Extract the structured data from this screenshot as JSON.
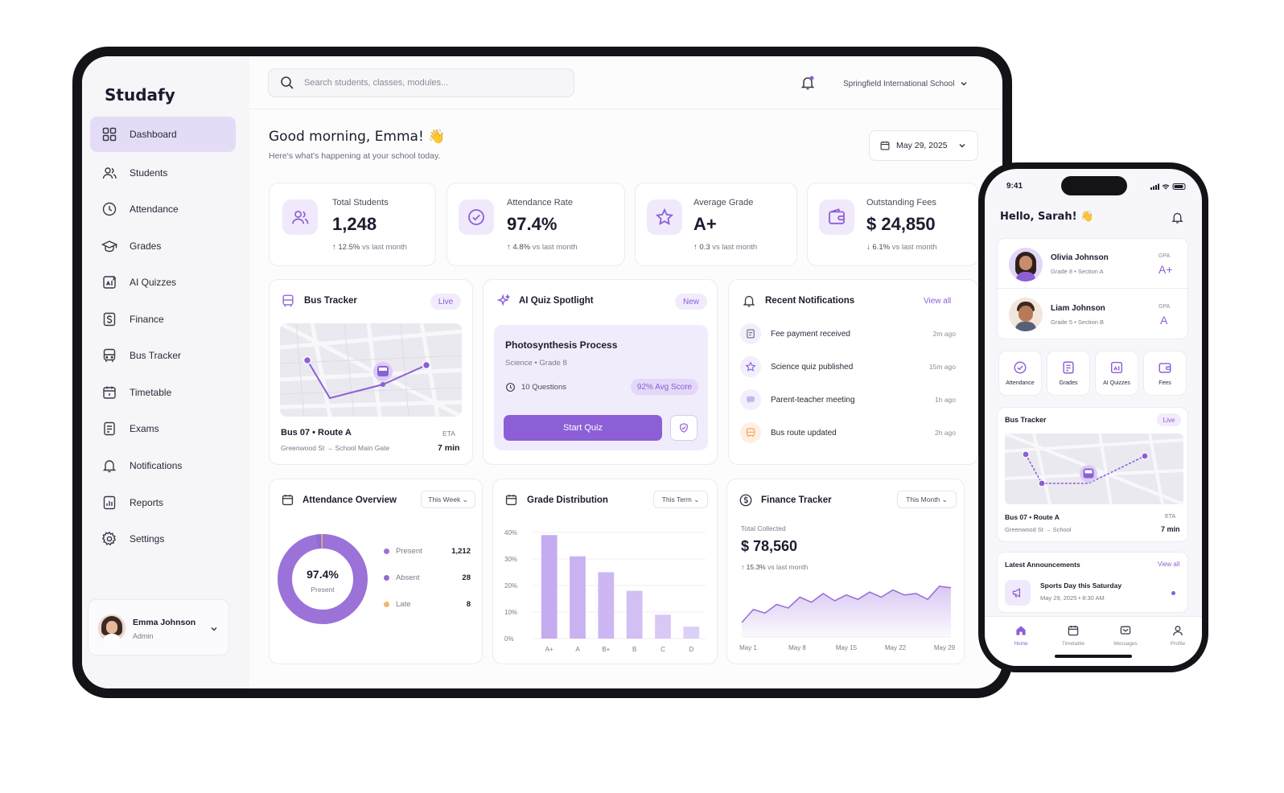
{
  "app": {
    "name": "Studafy"
  },
  "search": {
    "placeholder": "Search students, classes, modules..."
  },
  "school": "Springfield International School",
  "greeting": {
    "title": "Good morning, Emma! 👋",
    "subtitle": "Here's what's happening at your school today."
  },
  "date": "May 29, 2025",
  "nav": [
    {
      "label": "Dashboard",
      "icon": "grid-icon",
      "active": true
    },
    {
      "label": "Students",
      "icon": "users-icon"
    },
    {
      "label": "Attendance",
      "icon": "clock-icon"
    },
    {
      "label": "Grades",
      "icon": "graduation-cap-icon"
    },
    {
      "label": "AI Quizzes",
      "icon": "quiz-icon"
    },
    {
      "label": "Finance",
      "icon": "dollar-icon"
    },
    {
      "label": "Bus Tracker",
      "icon": "bus-icon"
    },
    {
      "label": "Timetable",
      "icon": "calendar-icon"
    },
    {
      "label": "Exams",
      "icon": "exam-icon"
    },
    {
      "label": "Notifications",
      "icon": "bell-icon"
    },
    {
      "label": "Reports",
      "icon": "report-icon"
    },
    {
      "label": "Settings",
      "icon": "gear-icon"
    }
  ],
  "user": {
    "name": "Emma Johnson",
    "role": "Admin"
  },
  "stats": [
    {
      "label": "Total Students",
      "value": "1,248",
      "delta": "12.5%",
      "delta_text": "vs last month",
      "direction": "up",
      "icon": "users-icon"
    },
    {
      "label": "Attendance Rate",
      "value": "97.4%",
      "delta": "4.8%",
      "delta_text": "vs last month",
      "direction": "up",
      "icon": "check-circle-icon"
    },
    {
      "label": "Average Grade",
      "value": "A+",
      "delta": "0.3",
      "delta_text": "vs last month",
      "direction": "up",
      "icon": "star-icon"
    },
    {
      "label": "Outstanding Fees",
      "value": "$ 24,850",
      "delta": "6.1%",
      "delta_text": "vs last month",
      "direction": "down",
      "icon": "wallet-icon"
    }
  ],
  "bus": {
    "title": "Bus Tracker",
    "badge": "Live",
    "route": "Bus 07 • Route A",
    "stops": "Greenwood St → School Main Gate",
    "eta_label": "ETA",
    "eta": "7 min"
  },
  "quiz": {
    "title": "AI Quiz Spotlight",
    "badge": "New",
    "name": "Photosynthesis Process",
    "meta": "Science  •  Grade 8",
    "questions": "10 Questions",
    "score": "92% Avg Score",
    "button": "Start Quiz"
  },
  "notifications": {
    "title": "Recent Notifications",
    "view_all": "View all",
    "items": [
      {
        "text": "Fee payment received",
        "time": "2m ago",
        "icon": "receipt-icon"
      },
      {
        "text": "Science quiz published",
        "time": "15m ago",
        "icon": "star-icon"
      },
      {
        "text": "Parent-teacher meeting",
        "time": "1h ago",
        "icon": "chat-icon"
      },
      {
        "text": "Bus route updated",
        "time": "2h ago",
        "icon": "bus-icon"
      }
    ]
  },
  "attendance": {
    "title": "Attendance Overview",
    "filter": "This Week",
    "center_value": "97.4%",
    "center_label": "Present",
    "legend": [
      {
        "label": "Present",
        "value": "1,212",
        "color": "#9a72d8"
      },
      {
        "label": "Absent",
        "value": "28",
        "color": "#8f6cd4"
      },
      {
        "label": "Late",
        "value": "8",
        "color": "#f2b56b"
      }
    ]
  },
  "grades": {
    "title": "Grade Distribution",
    "filter": "This Term"
  },
  "finance": {
    "title": "Finance Tracker",
    "filter": "This Month",
    "label": "Total Collected",
    "value": "$ 78,560",
    "delta": "15.3%",
    "delta_text": "vs last month"
  },
  "chart_data": [
    {
      "type": "pie",
      "title": "Attendance Overview",
      "categories": [
        "Present",
        "Absent",
        "Late"
      ],
      "values": [
        1212,
        28,
        8
      ]
    },
    {
      "type": "bar",
      "title": "Grade Distribution",
      "categories": [
        "A+",
        "A",
        "B+",
        "B",
        "C",
        "D"
      ],
      "values": [
        39,
        31,
        25,
        18,
        9,
        4.5
      ],
      "yticks": [
        "40%",
        "30%",
        "20%",
        "10%",
        "0%"
      ],
      "ylim": [
        0,
        40
      ]
    },
    {
      "type": "area",
      "title": "Finance Tracker",
      "xticks": [
        "May 1",
        "May 8",
        "May 15",
        "May 22",
        "May 29"
      ],
      "values": [
        20,
        38,
        33,
        45,
        40,
        55,
        48,
        60,
        50,
        58,
        52,
        62,
        55,
        65,
        58,
        60,
        52,
        70,
        68
      ]
    }
  ],
  "phone": {
    "time": "9:41",
    "greeting": "Hello, Sarah! 👋",
    "children": [
      {
        "name": "Olivia Johnson",
        "meta": "Grade 8  •  Section A",
        "gpa_label": "GPA",
        "gpa": "A+"
      },
      {
        "name": "Liam Johnson",
        "meta": "Grade 5  •  Section B",
        "gpa_label": "GPA",
        "gpa": "A"
      }
    ],
    "quick": [
      {
        "label": "Attendance",
        "icon": "check-circle-icon"
      },
      {
        "label": "Grades",
        "icon": "report-icon"
      },
      {
        "label": "AI Quizzes",
        "icon": "quiz-icon"
      },
      {
        "label": "Fees",
        "icon": "wallet-icon"
      }
    ],
    "bus": {
      "title": "Bus Tracker",
      "badge": "Live",
      "route": "Bus 07 • Route A",
      "stops": "Greenwood St → School",
      "eta_label": "ETA",
      "eta": "7 min"
    },
    "announcements": {
      "title": "Latest Announcements",
      "view_all": "View all",
      "item": "Sports Day this Saturday",
      "date": "May 29, 2025  •  8:30 AM"
    },
    "tabs": [
      "Home",
      "Timetable",
      "Messages",
      "Profile"
    ]
  },
  "colors": {
    "accent": "#8c5fd6",
    "accent_light": "#efe9fb",
    "late": "#f2b56b"
  }
}
